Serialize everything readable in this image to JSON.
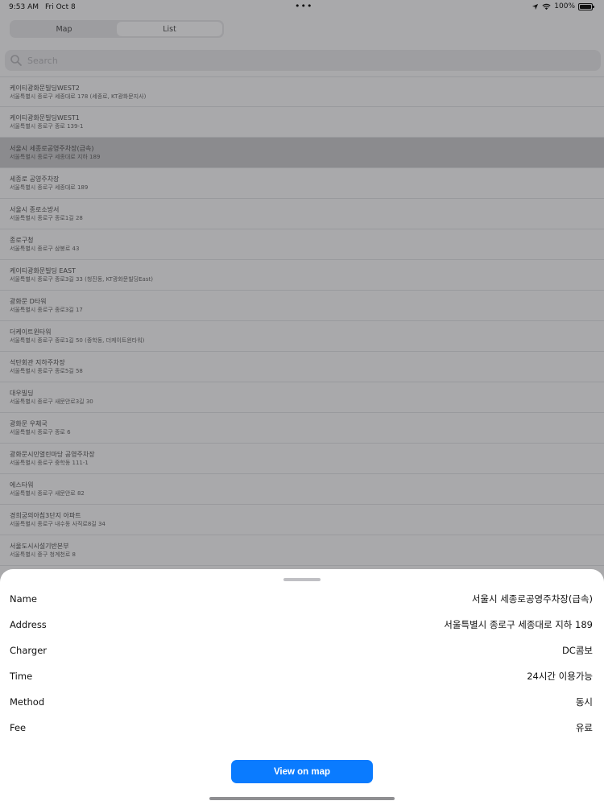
{
  "status_bar": {
    "time": "9:53 AM",
    "date": "Fri Oct 8",
    "battery": "100%"
  },
  "segments": [
    {
      "label": "Map",
      "active": false
    },
    {
      "label": "List",
      "active": true
    }
  ],
  "search": {
    "placeholder": "Search"
  },
  "list": [
    {
      "name": "케이티광화문빌딩WEST2",
      "address": "서울특별시 종로구 세종대로 178 (세종로, KT광화문지사)"
    },
    {
      "name": "케이티광화문빌딩WEST1",
      "address": "서울특별시 종로구 종로 139-1"
    },
    {
      "name": "서울시 세종로공영주차장(급속)",
      "address": "서울특별시 종로구 세종대로 지하 189"
    },
    {
      "name": "세종로 공영주차장",
      "address": "서울특별시 종로구 세종대로 189"
    },
    {
      "name": "서울시 종로소방서",
      "address": "서울특별시 종로구 종로1길 28"
    },
    {
      "name": "종로구청",
      "address": "서울특별시 종로구 삼봉로 43"
    },
    {
      "name": "케이티광화문빌딩 EAST",
      "address": "서울특별시 종로구 종로3길 33 (청진동, KT광화문빌딩East)"
    },
    {
      "name": "광화문 D타워",
      "address": "서울특별시 종로구 종로3길 17"
    },
    {
      "name": "더케이트윈타워",
      "address": "서울특별시 종로구 종로1길 50 (중학동, 더케이트윈타워)"
    },
    {
      "name": "석탄회관 지하주차장",
      "address": "서울특별시 종로구 종로5길 58"
    },
    {
      "name": "대우빌딩",
      "address": "서울특별시 종로구 새문안로3길 30"
    },
    {
      "name": "광화문 우체국",
      "address": "서울특별시 종로구 종로 6"
    },
    {
      "name": "광화문시민열린마당 공영주차장",
      "address": "서울특별시 종로구 중학동 111-1"
    },
    {
      "name": "에스타워",
      "address": "서울특별시 종로구 새문안로 82"
    },
    {
      "name": "경희궁의아침3단지 아파트",
      "address": "서울특별시 종로구 내수동 사직로8길 34"
    },
    {
      "name": "서울도시시설기반본부",
      "address": "서울특별시 중구 청계천로 8"
    }
  ],
  "selected_index": 2,
  "detail": [
    {
      "label": "Name",
      "value": "서울시 세종로공영주차장(급속)"
    },
    {
      "label": "Address",
      "value": "서울특별시 종로구 세종대로 지하 189"
    },
    {
      "label": "Charger",
      "value": "DC콤보"
    },
    {
      "label": "Time",
      "value": "24시간 이용가능"
    },
    {
      "label": "Method",
      "value": "동시"
    },
    {
      "label": "Fee",
      "value": "유료"
    }
  ],
  "map_button_label": "View on map",
  "accent_color": "#0A7BFF"
}
